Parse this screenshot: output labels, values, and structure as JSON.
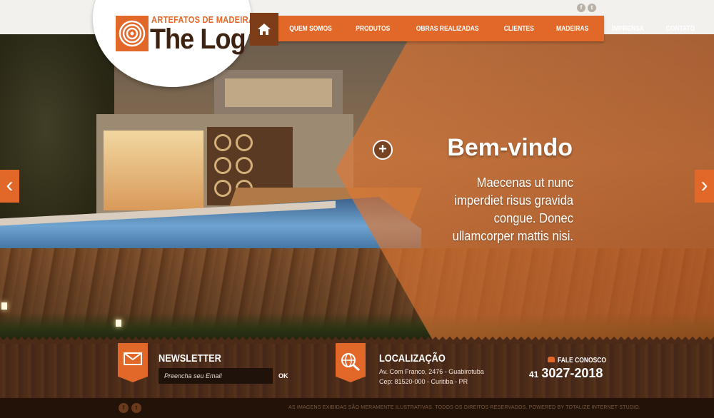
{
  "brand": {
    "subtitle": "ARTEFATOS DE MADEIRA",
    "name": "The Log",
    "accent_color": "#e2682a",
    "dark_color": "#3d2211"
  },
  "header": {
    "social": [
      "f",
      "t"
    ]
  },
  "nav": {
    "home_icon": "home-icon",
    "items": [
      "QUEM SOMOS",
      "PRODUTOS",
      "OBRAS REALIZADAS",
      "CLIENTES",
      "MADEIRAS",
      "IMPRENSA",
      "CONTATO"
    ]
  },
  "hero": {
    "title": "Bem-vindo",
    "text": "Maecenas ut nunc imperdiet risus gravida congue. Donec ullamcorper mattis nisi.",
    "plus_label": "+",
    "prev_label": "‹",
    "next_label": "›"
  },
  "newsletter": {
    "heading": "NEWSLETTER",
    "placeholder": "Preencha seu Email",
    "ok_label": "OK",
    "icon": "envelope-icon"
  },
  "location": {
    "heading": "LOCALIZAÇÃO",
    "address_line1": "Av. Com Franco, 2476 - Guabirotuba",
    "address_line2": "Cep: 81520-000 - Curitiba - PR",
    "icon": "globe-search-icon"
  },
  "contact": {
    "label": "FALE CONOSCO",
    "ddd": "41",
    "number": "3027-2018"
  },
  "footer": {
    "social": [
      "f",
      "t"
    ],
    "copyright": "AS IMAGENS EXIBIDAS SÃO MERAMENTE ILUSTRATIVAS. TODOS OS DIREITOS RESERVADOS. POWERED BY TOTALIZE INTERNET STUDIO."
  }
}
